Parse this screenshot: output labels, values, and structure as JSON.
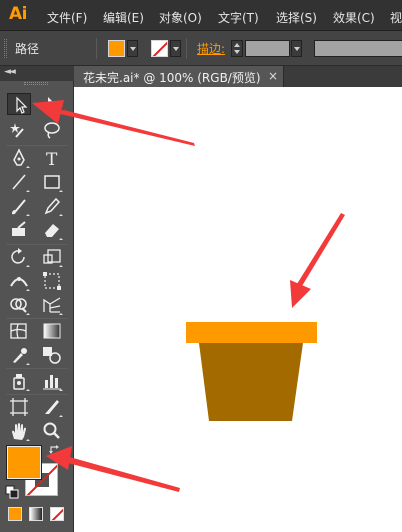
{
  "app": {
    "logo": "Ai",
    "accent": "#ff9a00"
  },
  "menu": {
    "items": [
      "文件(F)",
      "编辑(E)",
      "对象(O)",
      "文字(T)",
      "选择(S)",
      "效果(C)",
      "视"
    ]
  },
  "control_bar": {
    "selection_type": "路径",
    "fill_color": "#ff9900",
    "stroke_label": "描边:",
    "stroke_color": "none"
  },
  "document": {
    "tab_title": "花未完.ai* @ 100% (RGB/预览)",
    "close_glyph": "×"
  },
  "toolbox": {
    "tools": [
      "selection",
      "direct-selection",
      "magic-wand",
      "lasso",
      "pen",
      "type",
      "line-segment",
      "rectangle",
      "paintbrush",
      "pencil",
      "blob-brush",
      "eraser",
      "rotate",
      "scale",
      "width",
      "free-transform",
      "shape-builder",
      "perspective-grid",
      "mesh",
      "gradient",
      "eyedropper",
      "blend",
      "symbol-sprayer",
      "column-graph",
      "artboard",
      "slice",
      "hand",
      "zoom"
    ],
    "fill_color": "#ff9900",
    "stroke_color": "#ffffff"
  },
  "artwork": {
    "pot_rim_color": "#ff9900",
    "pot_body_color": "#a36a00"
  },
  "annotations": {
    "arrow_color": "#f23a3a",
    "count": 3
  }
}
